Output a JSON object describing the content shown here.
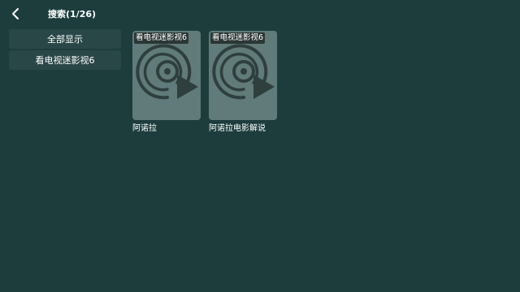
{
  "header": {
    "back_icon": "chevron-left-icon",
    "title": "搜索(1/26)"
  },
  "sidebar": {
    "items": [
      {
        "label": "全部显示"
      },
      {
        "label": "看电视迷影视6"
      }
    ]
  },
  "results": [
    {
      "source_badge": "看电视迷影视6",
      "title": "阿诺拉",
      "poster_icon": "video-disc-play-icon"
    },
    {
      "source_badge": "看电视迷影视6",
      "title": "阿诺拉电影解说",
      "poster_icon": "video-disc-play-icon"
    }
  ],
  "colors": {
    "background": "#1d3d3d",
    "sidebar_item": "#2a4747",
    "poster_placeholder": "#607b79",
    "icon": "#2f3f3e"
  }
}
